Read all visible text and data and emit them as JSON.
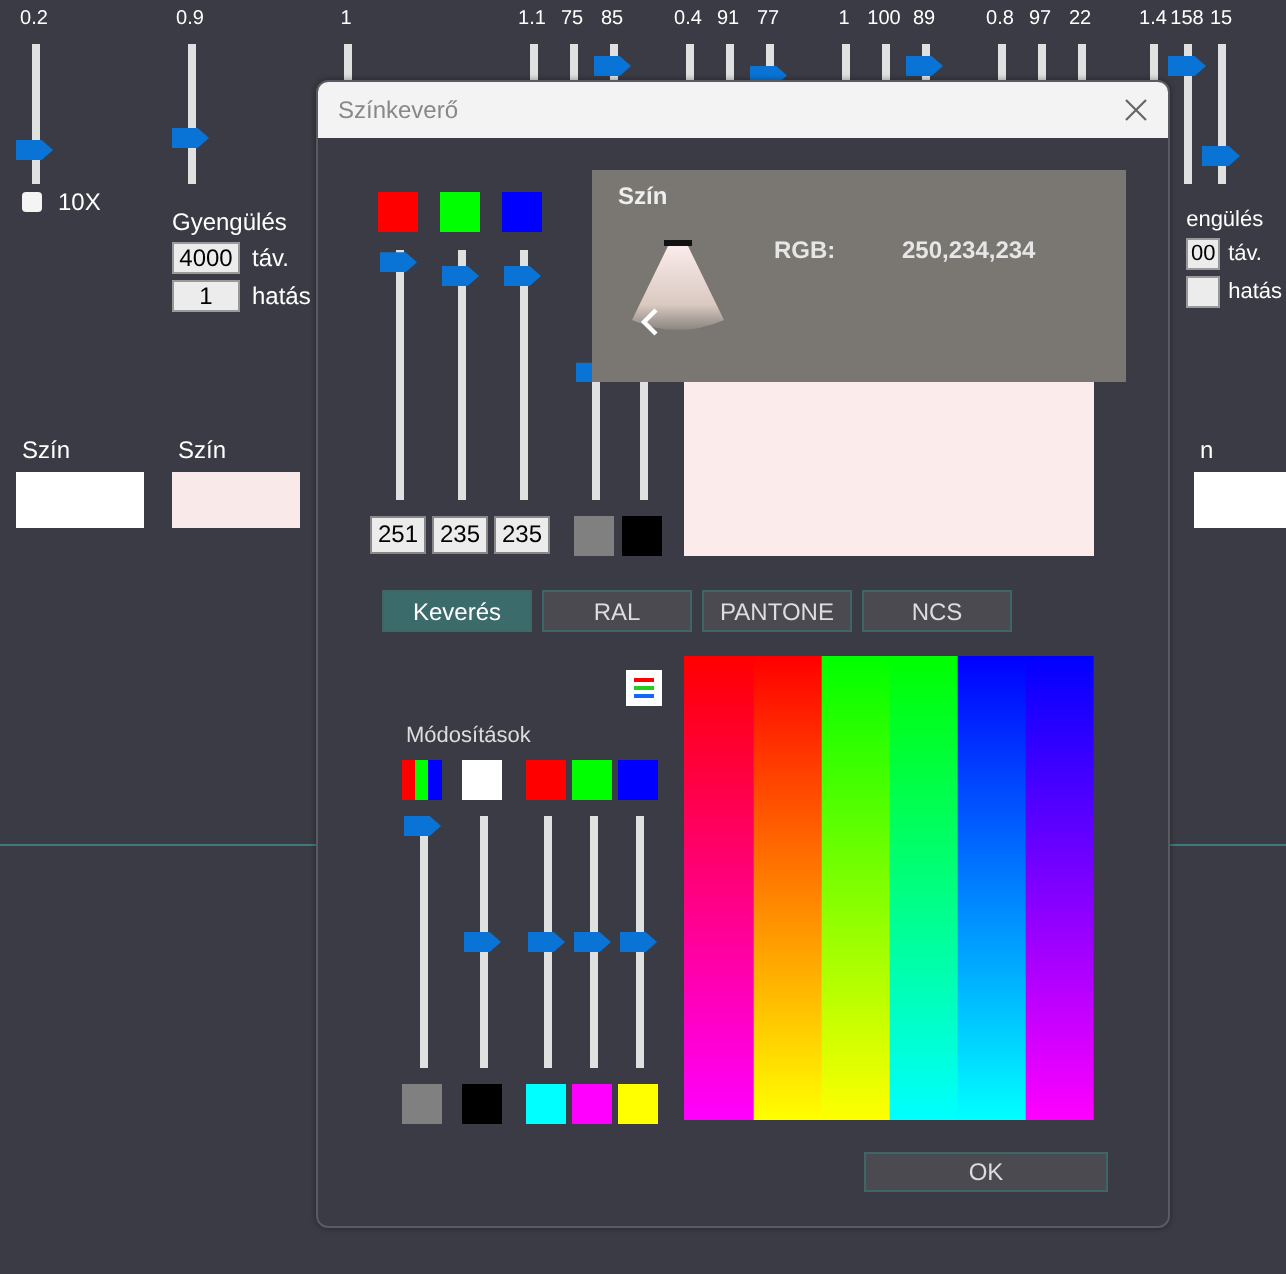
{
  "background": {
    "slider_groups": [
      [
        {
          "label": "0.2",
          "level": 0.2
        }
      ],
      [
        {
          "label": "0.9",
          "level": 0.3
        }
      ],
      [
        {
          "label": "1"
        }
      ],
      [
        {
          "label": "1.1"
        },
        {
          "label": "75"
        },
        {
          "label": "85",
          "level": 0.9
        }
      ],
      [
        {
          "label": "0.4"
        },
        {
          "label": "91"
        },
        {
          "label": "77",
          "level": 0.82
        }
      ],
      [
        {
          "label": "1"
        },
        {
          "label": "100"
        },
        {
          "label": "89",
          "level": 0.9
        }
      ],
      [
        {
          "label": "0.8"
        },
        {
          "label": "97"
        },
        {
          "label": "22"
        }
      ],
      [
        {
          "label": "1.4"
        },
        {
          "label": "158",
          "level": 0.9
        },
        {
          "label": "15",
          "level": 0.15
        }
      ]
    ],
    "checkbox": {
      "label": "10X",
      "checked": false
    },
    "attenuation_left": {
      "title": "Gyengülés",
      "distance": "4000",
      "distance_unit": "táv.",
      "effect": "1",
      "effect_unit": "hatás"
    },
    "attenuation_right": {
      "title": "engülés",
      "distance": "00",
      "distance_unit": "táv.",
      "effect_unit": "hatás"
    },
    "color_swatches_left": [
      {
        "label": "Szín",
        "color": "#ffffff"
      },
      {
        "label": "Szín",
        "color": "#f9e9e9"
      }
    ],
    "color_swatch_right": {
      "label": "n",
      "color": "#ffffff"
    }
  },
  "dialog": {
    "title": "Színkeverő",
    "mixer": [
      {
        "kind": "channel",
        "top_swatch": {
          "color": "#ff0000"
        },
        "level": 0.99,
        "value": "251"
      },
      {
        "kind": "channel",
        "top_swatch": {
          "color": "#00ff00"
        },
        "level": 0.93,
        "value": "235"
      },
      {
        "kind": "channel",
        "top_swatch": {
          "color": "#0000ff"
        },
        "level": 0.93,
        "value": "235"
      },
      {
        "kind": "shade",
        "level": 0.51,
        "bottom_swatch": {
          "color": "#808080"
        }
      },
      {
        "kind": "shade",
        "bottom_swatch": {
          "color": "#000000"
        }
      }
    ],
    "preview": {
      "color": "#fbebeb"
    },
    "popup": {
      "title": "Szín",
      "rgb_label": "RGB:",
      "rgb_value": "250,234,234"
    },
    "tabs": [
      {
        "label": "Keverés",
        "selected": true
      },
      {
        "label": "RAL",
        "selected": false
      },
      {
        "label": "PANTONE",
        "selected": false
      },
      {
        "label": "NCS",
        "selected": false
      }
    ],
    "adjustments": {
      "title": "Módosítások",
      "sliders": [
        {
          "kind": "multi",
          "level": 1.0,
          "bottom_swatch": {
            "color": "#808080"
          }
        },
        {
          "kind": "solid",
          "top_swatch": {
            "color": "#ffffff"
          },
          "level": 0.5,
          "bottom_swatch": {
            "color": "#000000"
          }
        },
        {
          "kind": "solid",
          "top_swatch": {
            "color": "#ff0000"
          },
          "level": 0.5,
          "bottom_swatch": {
            "color": "#00ffff"
          }
        },
        {
          "kind": "solid",
          "top_swatch": {
            "color": "#00ff00"
          },
          "level": 0.5,
          "bottom_swatch": {
            "color": "#ff00ff"
          }
        },
        {
          "kind": "solid",
          "top_swatch": {
            "color": "#0000ff"
          },
          "level": 0.5,
          "bottom_swatch": {
            "color": "#ffff00"
          }
        }
      ]
    },
    "ok_button": "OK"
  }
}
